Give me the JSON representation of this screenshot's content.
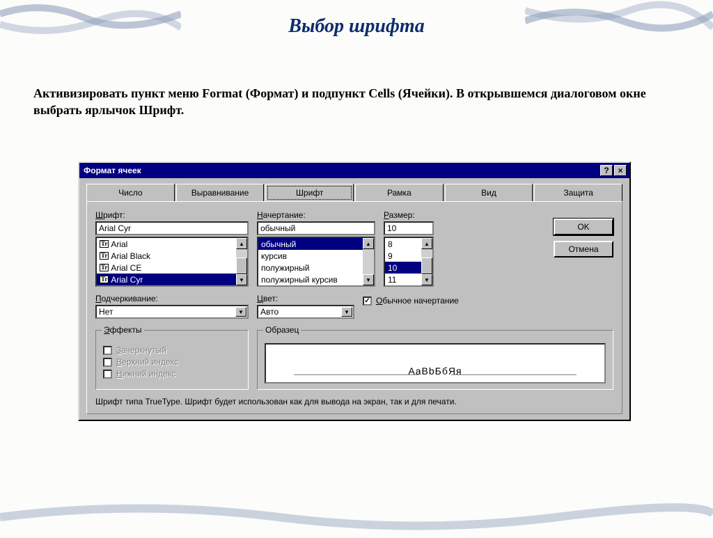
{
  "slide": {
    "title": "Выбор шрифта",
    "body": "Активизировать пункт меню Format (Формат) и подпункт Cells (Ячейки). В открывшемся диалоговом окне выбрать ярлычок Шрифт."
  },
  "dialog": {
    "title": "Формат ячеек",
    "help_btn": "?",
    "close_btn": "×",
    "tabs": {
      "number": "Число",
      "alignment": "Выравнивание",
      "font": "Шрифт",
      "border": "Рамка",
      "patterns": "Вид",
      "protection": "Защита"
    },
    "labels": {
      "font": "Шрифт:",
      "font_hot": "Ш",
      "style": "Начертание:",
      "style_hot": "Н",
      "size": "Размер:",
      "size_hot": "Р",
      "underline": "Подчеркивание:",
      "underline_hot": "П",
      "color": "Цвет:",
      "color_hot": "Ц",
      "normal_font": "Обычное начертание",
      "normal_font_hot": "О",
      "effects": "Эффекты",
      "effects_hot": "Э",
      "strike": "Зачеркнутый",
      "strike_hot": "З",
      "super": "Верхний индекс",
      "super_hot": "В",
      "sub": "Нижний индекс",
      "sub_hot": "Н",
      "sample": "Образец"
    },
    "inputs": {
      "font": "Arial Cyr",
      "style": "обычный",
      "size": "10",
      "underline": "Нет",
      "color": "Авто"
    },
    "font_list": [
      "Arial",
      "Arial Black",
      "Arial CE",
      "Arial Cyr"
    ],
    "font_list_selected": 3,
    "style_list": [
      "обычный",
      "курсив",
      "полужирный",
      "полужирный курсив"
    ],
    "style_list_selected": 0,
    "size_list": [
      "8",
      "9",
      "10",
      "11"
    ],
    "size_list_selected": 2,
    "checkbox_normal": true,
    "buttons": {
      "ok": "OK",
      "cancel": "Отмена"
    },
    "sample_text": "AaBbБбЯя",
    "hint": "Шрифт типа TrueType. Шрифт будет использован как для вывода на экран, так и для печати."
  }
}
